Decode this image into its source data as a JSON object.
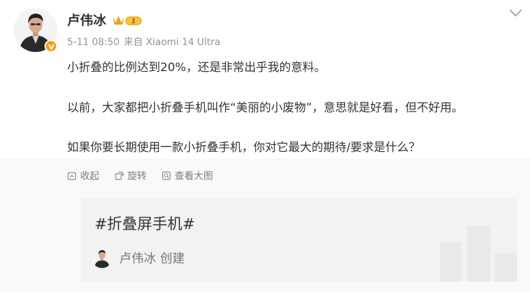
{
  "post": {
    "author": "卢伟冰",
    "level_badge": "1",
    "date": "5-11 08:50",
    "source": "来自 Xiaomi 14 Ultra",
    "paragraphs": [
      "小折叠的比例达到20%，还是非常出乎我的意料。",
      "以前，大家都把小折叠手机叫作“美丽的小废物”，意思就是好看，但不好用。",
      "如果你要长期使用一款小折叠手机，你对它最大的期待/要求是什么？"
    ]
  },
  "actions": {
    "collapse": "收起",
    "rotate": "旋转",
    "view_large": "查看大图"
  },
  "topic_card": {
    "title": "#折叠屏手机#",
    "creator": "卢伟冰 创建"
  },
  "colors": {
    "text": "#333333",
    "meta": "#939393",
    "badge_orange": "#f39c12",
    "level_gold": "#e6a817",
    "card_bg": "#f2f2f2"
  },
  "icons": {
    "more": "chevron-down-icon",
    "collapse": "collapse-icon",
    "rotate": "rotate-icon",
    "view_large": "zoom-in-icon",
    "verified": "verified-v-icon",
    "level": "level-badge-icon"
  }
}
